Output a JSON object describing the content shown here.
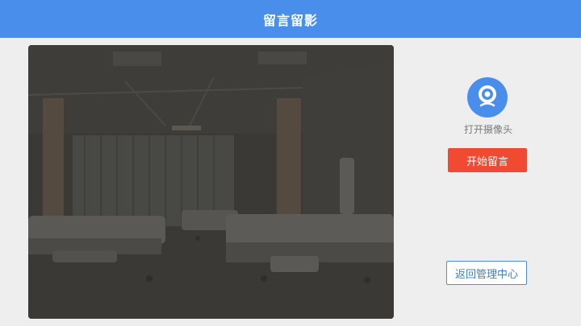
{
  "header": {
    "title": "留言留影"
  },
  "preview": {
    "image": "hospital-ward-camera-preview"
  },
  "sidebar": {
    "camera_icon": "webcam-icon",
    "camera_label": "打开摄像头",
    "start_label": "开始留言",
    "back_label": "返回管理中心"
  },
  "colors": {
    "header_bg": "#4a8eec",
    "accent_blue": "#4a8eec",
    "start_red": "#f04a33",
    "page_bg": "#eeeeee"
  }
}
